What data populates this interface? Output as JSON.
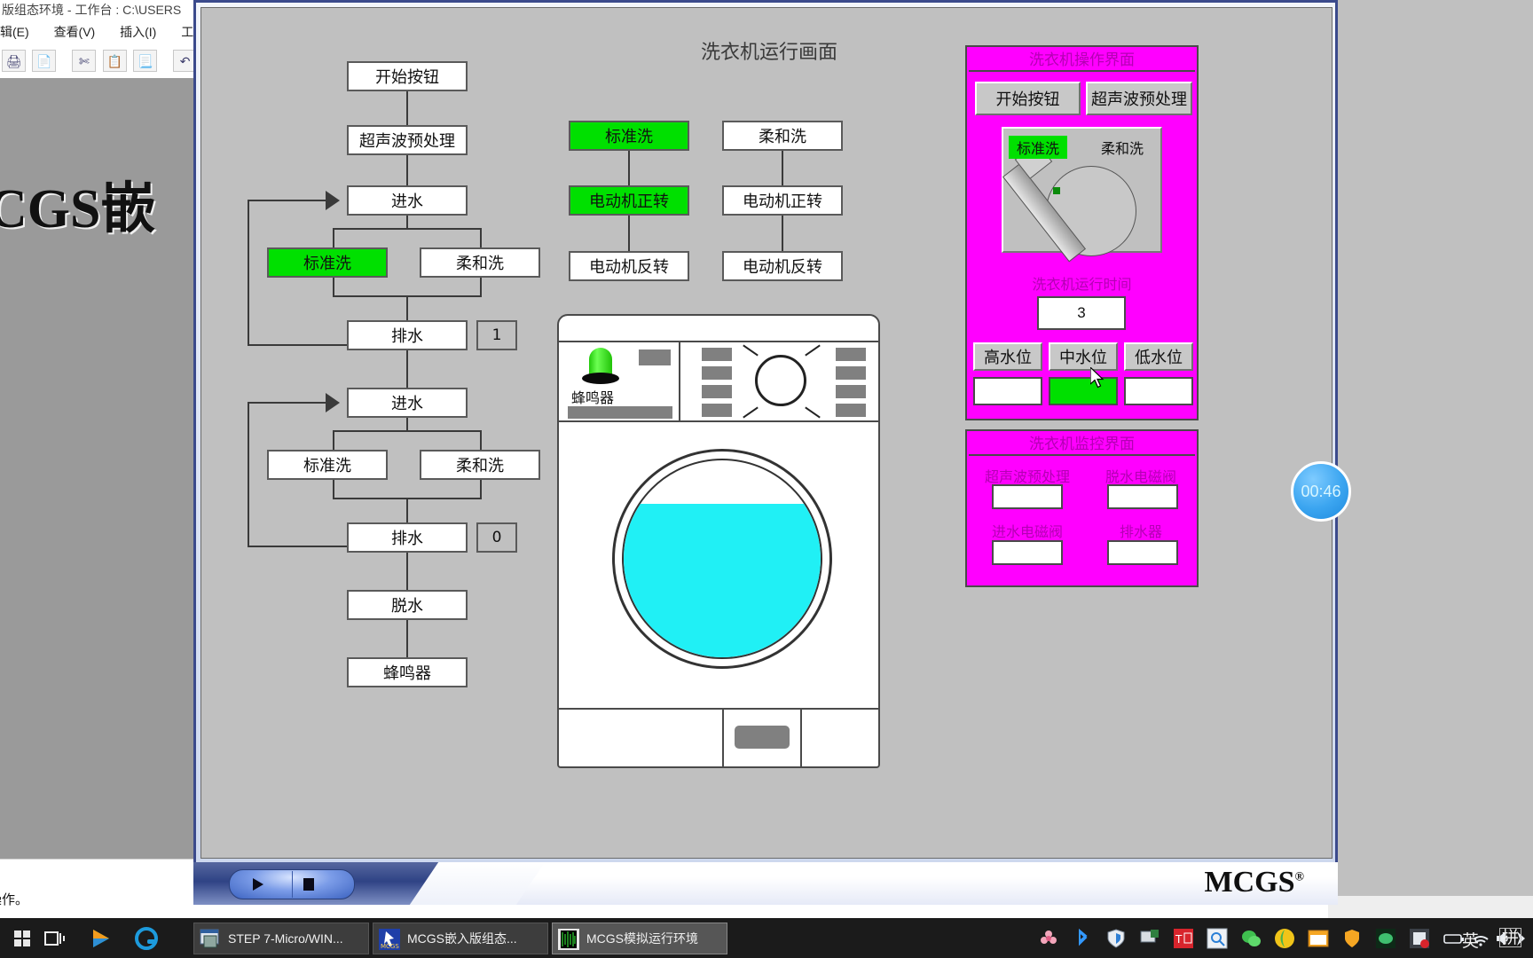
{
  "editor": {
    "title": "版组态环境 - 工作台 : C:\\USERS",
    "minimize_label": "—",
    "menu": [
      "辑(E)",
      "查看(V)",
      "插入(I)",
      "工具(T"
    ],
    "logo_text": "CGS嵌",
    "status_text": "待操作。"
  },
  "sim": {
    "title": "洗衣机运行画面",
    "brand": "MCGS",
    "brand_sup": "®",
    "play_icon": "play-icon",
    "stop_icon": "stop-icon"
  },
  "flow": {
    "start_button": "开始按钮",
    "ultrasonic": "超声波预处理",
    "inlet_1": "进水",
    "standard_wash_1": "标准洗",
    "gentle_wash_1": "柔和洗",
    "drain_1": "排水",
    "counter_1": "1",
    "inlet_2": "进水",
    "standard_wash_2": "标准洗",
    "gentle_wash_2": "柔和洗",
    "drain_2": "排水",
    "counter_2": "0",
    "spin": "脱水",
    "buzzer": "蜂鸣器",
    "col_b": {
      "standard_wash": "标准洗",
      "motor_forward": "电动机正转",
      "motor_reverse": "电动机反转"
    },
    "col_c": {
      "gentle_wash": "柔和洗",
      "motor_forward": "电动机正转",
      "motor_reverse": "电动机反转"
    }
  },
  "machine": {
    "buzzer_label": "蜂鸣器",
    "lamp_state": "on",
    "water_color": "#20f0f5"
  },
  "operation_panel": {
    "title": "洗衣机操作界面",
    "start_button": "开始按钮",
    "ultrasonic_button": "超声波预处理",
    "standard_wash_chip": "标准洗",
    "gentle_wash_chip": "柔和洗",
    "runtime_label": "洗衣机运行时间",
    "runtime_value": "3",
    "level_buttons": [
      "高水位",
      "中水位",
      "低水位"
    ],
    "level_indicators": [
      "",
      "",
      ""
    ],
    "level_active_index": 1
  },
  "monitor_panel": {
    "title": "洗衣机监控界面",
    "items": [
      {
        "label": "超声波预处理",
        "value": ""
      },
      {
        "label": "脱水电磁阀",
        "value": ""
      },
      {
        "label": "进水电磁阀",
        "value": ""
      },
      {
        "label": "排水器",
        "value": ""
      }
    ]
  },
  "timer": {
    "value": "00:46"
  },
  "taskbar": {
    "tasks": [
      {
        "label": "STEP 7-Micro/WIN...",
        "active": false
      },
      {
        "label": "MCGS嵌入版组态...",
        "active": false
      },
      {
        "label": "MCGS模拟运行环境",
        "active": true
      }
    ],
    "tray_text": [
      "英",
      "拼"
    ]
  },
  "colors": {
    "magenta": "#ff00ff",
    "green": "#00e000",
    "water": "#20f0f5",
    "panel_gray": "#c0c0c0",
    "frame_blue": "#3b4a8c"
  }
}
